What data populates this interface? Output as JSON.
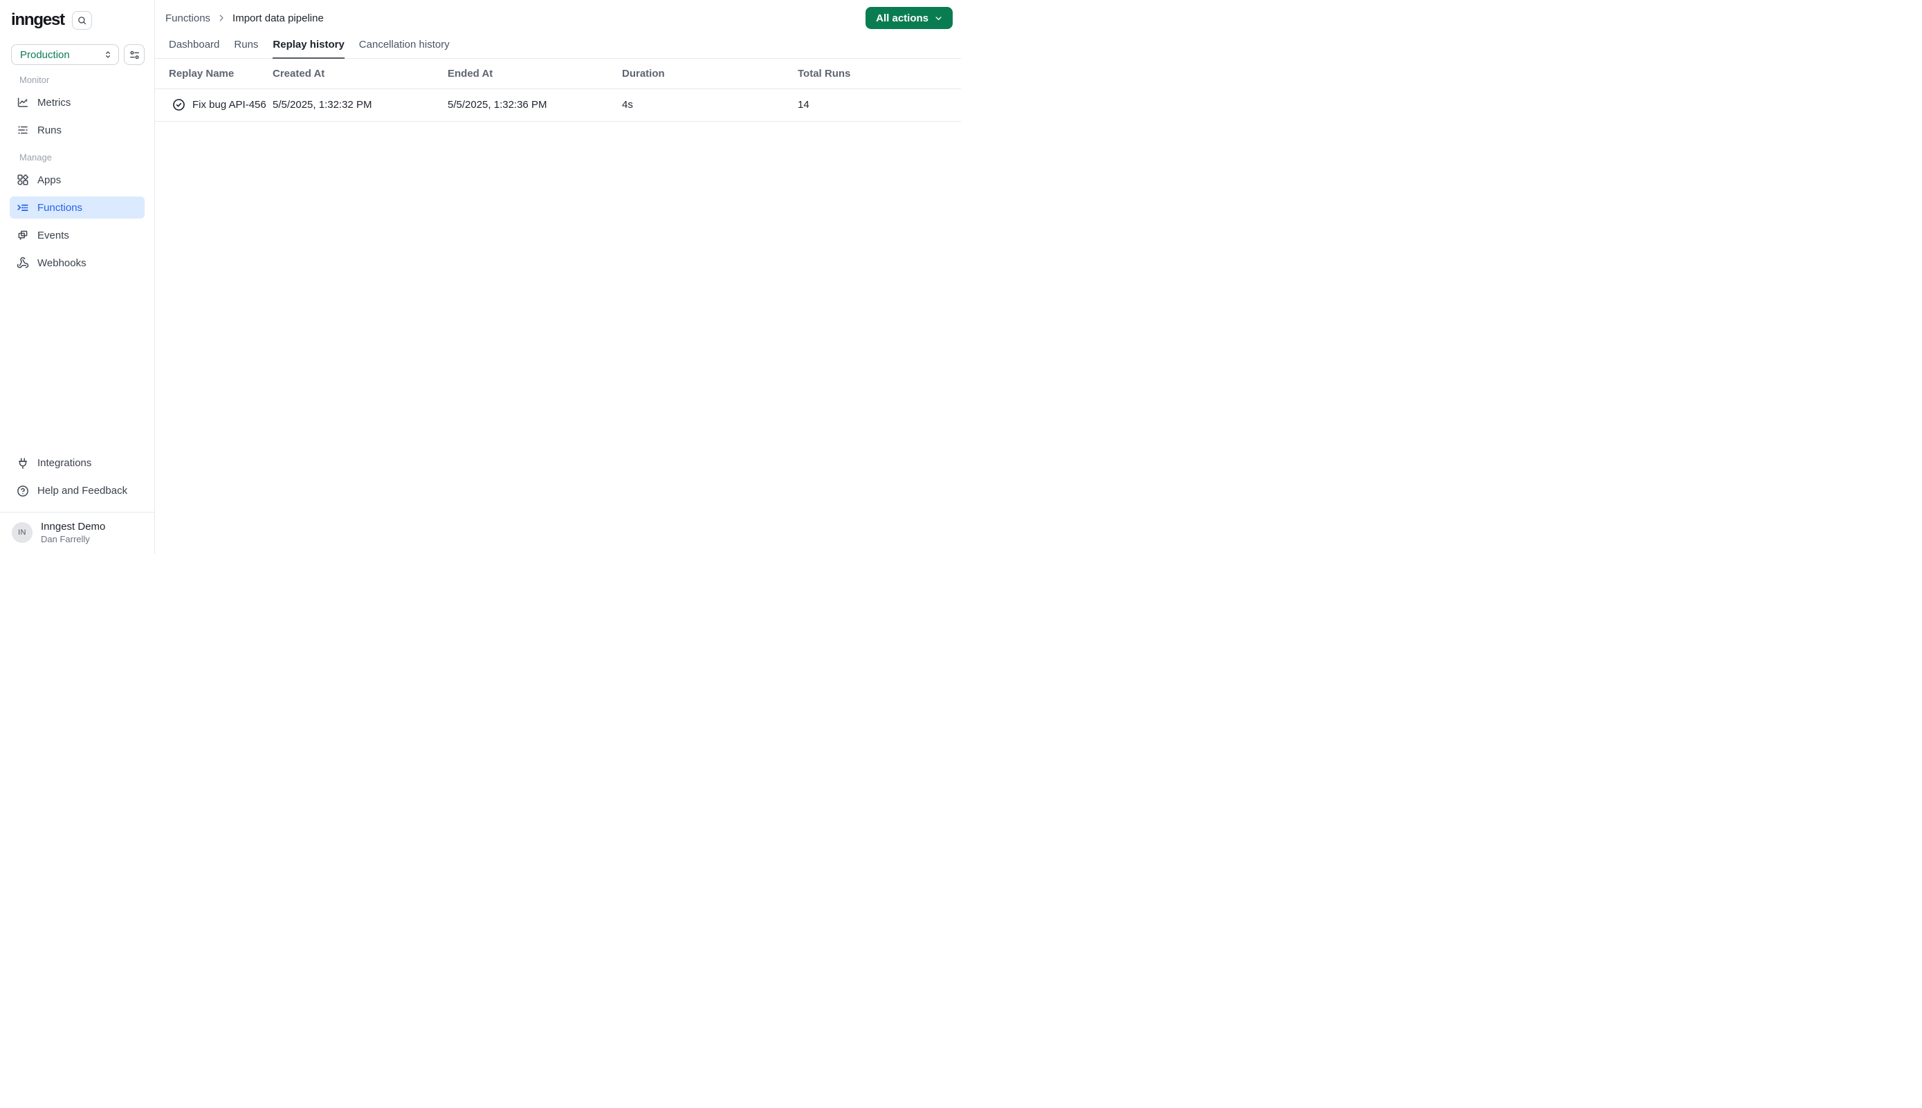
{
  "app": {
    "logo_text": "inngest"
  },
  "colors": {
    "accent": "#0a7c52",
    "active_blue": "#2563eb",
    "active_blue_bg": "#dbeafe"
  },
  "sidebar": {
    "env_switcher": {
      "value": "Production"
    },
    "sections": [
      {
        "label": "Monitor",
        "items": [
          {
            "label": "Metrics",
            "icon": "chart-line-icon",
            "active": false
          },
          {
            "label": "Runs",
            "icon": "list-icon",
            "active": false
          }
        ]
      },
      {
        "label": "Manage",
        "items": [
          {
            "label": "Apps",
            "icon": "shapes-grid-icon",
            "active": false
          },
          {
            "label": "Functions",
            "icon": "function-list-icon",
            "active": true
          },
          {
            "label": "Events",
            "icon": "copy-windows-icon",
            "active": false
          },
          {
            "label": "Webhooks",
            "icon": "webhook-icon",
            "active": false
          }
        ]
      }
    ],
    "footer_items": [
      {
        "label": "Integrations",
        "icon": "plug-icon"
      },
      {
        "label": "Help and Feedback",
        "icon": "help-circle-icon"
      }
    ],
    "user": {
      "initials": "IN",
      "org": "Inngest Demo",
      "name": "Dan Farrelly"
    }
  },
  "header": {
    "breadcrumb": {
      "parent": "Functions",
      "current": "Import data pipeline"
    },
    "actions_button_label": "All actions"
  },
  "tabs": [
    {
      "label": "Dashboard",
      "active": false
    },
    {
      "label": "Runs",
      "active": false
    },
    {
      "label": "Replay history",
      "active": true
    },
    {
      "label": "Cancellation history",
      "active": false
    }
  ],
  "table": {
    "columns": [
      "Replay Name",
      "Created At",
      "Ended At",
      "Duration",
      "Total Runs"
    ],
    "rows": [
      {
        "status": "completed",
        "name": "Fix bug API-456",
        "created_at": "5/5/2025, 1:32:32 PM",
        "ended_at": "5/5/2025, 1:32:36 PM",
        "duration": "4s",
        "total_runs": "14"
      }
    ]
  }
}
